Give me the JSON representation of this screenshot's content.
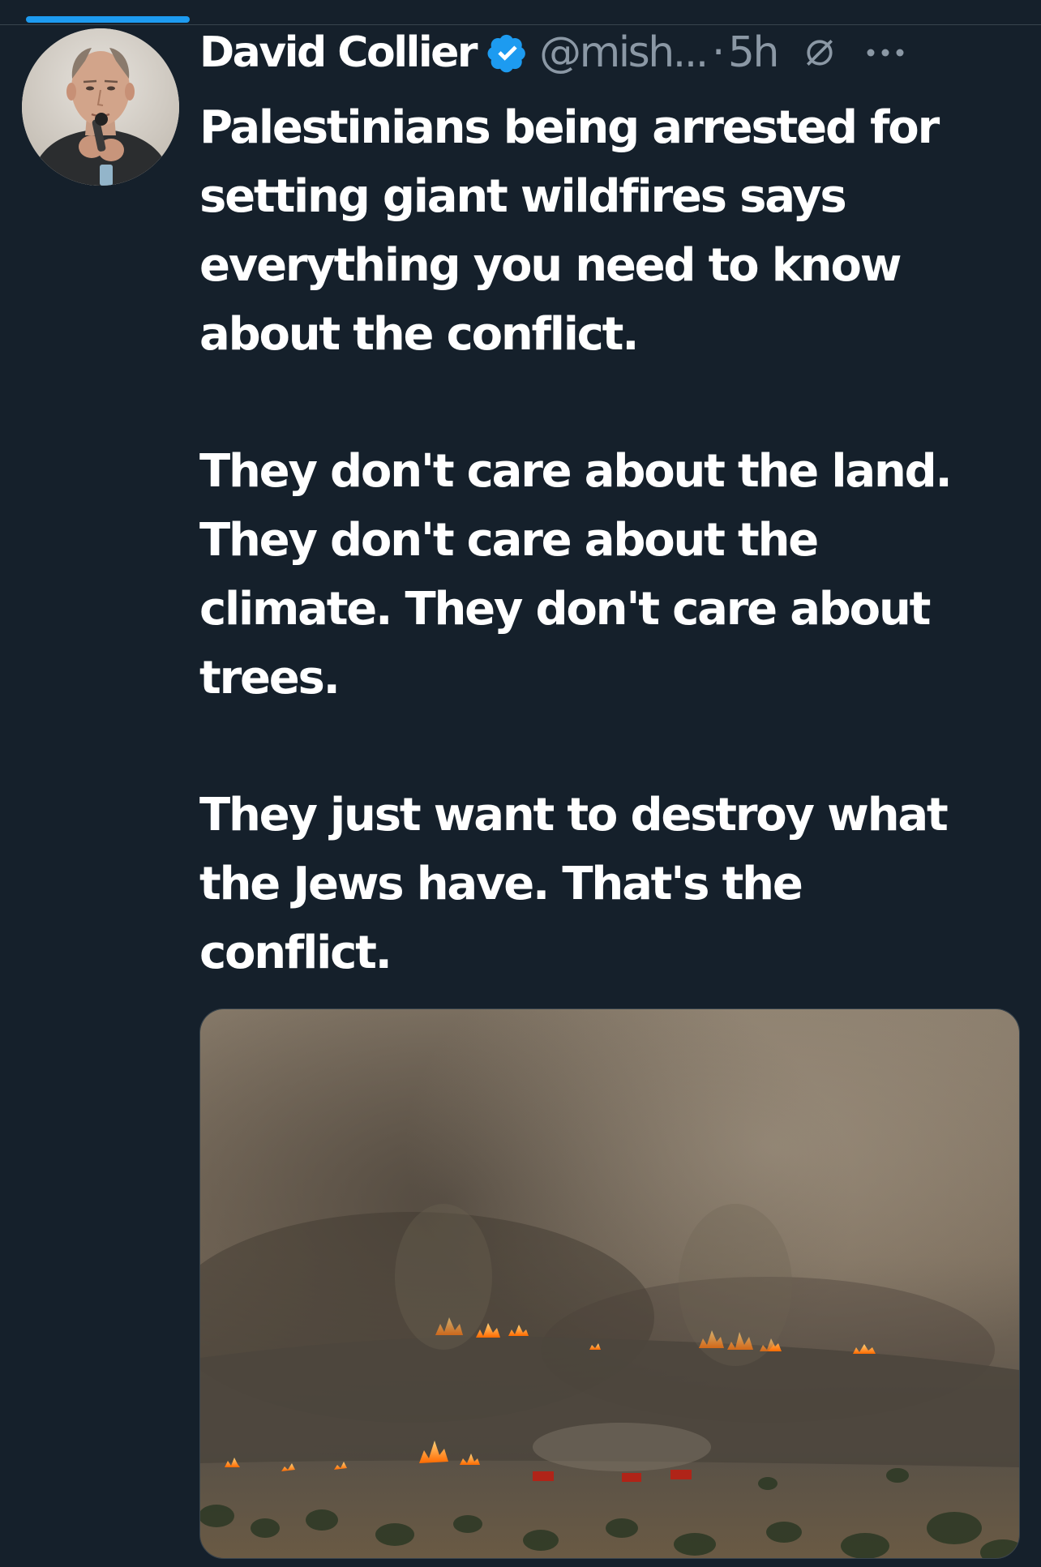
{
  "tweet": {
    "display_name": "David Collier",
    "handle": "@mish...",
    "separator": "·",
    "time": "5h",
    "paragraphs": [
      "Palestinians being arrested for\nsetting giant wildfires says\neverything you need to know\nabout the conflict.",
      "They don't care about the land.\nThey don't care about the\nclimate. They don't care about\ntrees.",
      "They just want to destroy what\nthe Jews have. That's the\nconflict."
    ]
  },
  "colors": {
    "background": "#15202b",
    "accent": "#1d9bf0",
    "secondary_text": "#8b98a5",
    "divider": "#38444d"
  },
  "icons": {
    "verified": "verified-badge-icon",
    "not_following": "prohibited-circle-icon",
    "more": "more-horizontal-icon"
  }
}
